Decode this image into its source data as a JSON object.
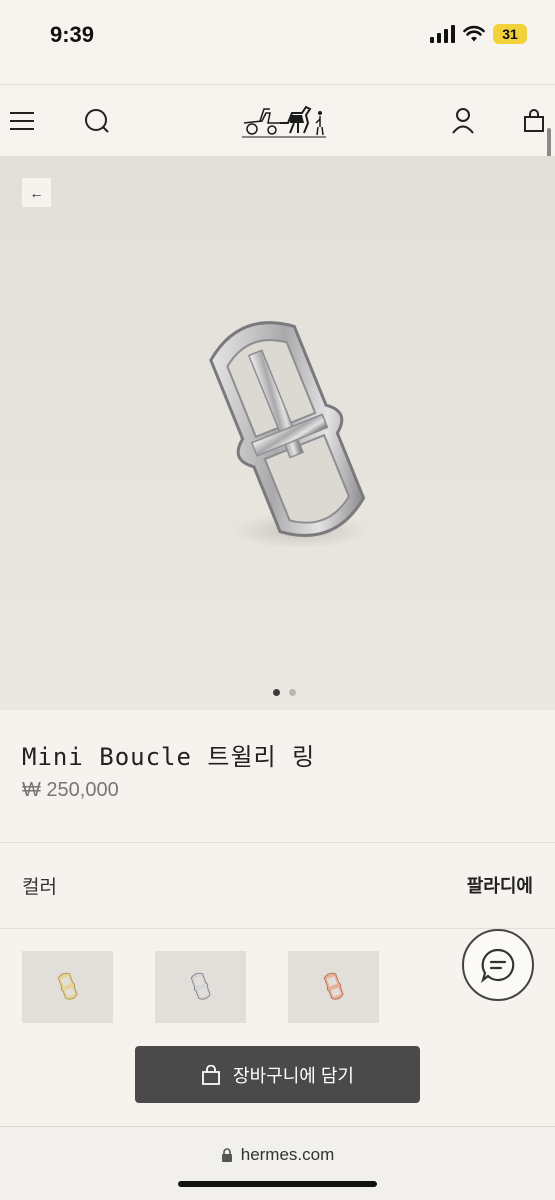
{
  "status": {
    "time": "9:39",
    "battery": "31"
  },
  "header": {
    "menu_icon": "hamburger-menu-icon",
    "search_icon": "search-icon",
    "logo": "hermes-carriage-logo",
    "account_icon": "user-icon",
    "bag_icon": "shopping-bag-icon"
  },
  "gallery": {
    "back_arrow": "←",
    "slide_count": 2,
    "active_slide": 1
  },
  "product": {
    "title": "Mini Boucle 트윌리 링",
    "price": "₩ 250,000"
  },
  "color": {
    "label": "컬러",
    "selected": "팔라디에",
    "swatches": [
      {
        "name": "gold",
        "hex": "#d9c07a"
      },
      {
        "name": "palladium",
        "hex": "#c9c9c9"
      },
      {
        "name": "rose-gold",
        "hex": "#d99b7f"
      }
    ]
  },
  "cart": {
    "label": "장바구니에 담기"
  },
  "browser": {
    "url": "hermes.com"
  }
}
